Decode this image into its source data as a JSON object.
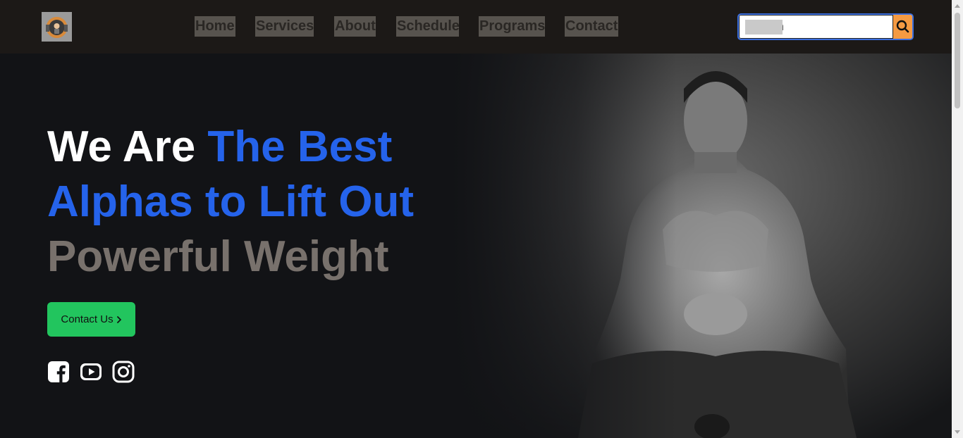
{
  "logo": {
    "icon": "gym-kettlebell-logo-icon"
  },
  "nav": {
    "items": [
      {
        "label": "Home"
      },
      {
        "label": "Services"
      },
      {
        "label": "About"
      },
      {
        "label": "Schedule"
      },
      {
        "label": "Programs"
      },
      {
        "label": "Contact"
      }
    ]
  },
  "search": {
    "placeholder": "Search",
    "button_icon": "search-icon",
    "button_color": "#f59a42",
    "border_color": "#3b6fe0"
  },
  "hero": {
    "headline_parts": {
      "we_are": "We Are ",
      "the_best": "The Best",
      "alphas": "Alphas to Lift Out",
      "powerful": "Powerful Weight"
    },
    "colors": {
      "white": "#ffffff",
      "blue": "#2563eb",
      "gray": "#78716c"
    },
    "cta": {
      "label": "Contact Us",
      "icon": "chevron-right-icon",
      "color": "#22c55e"
    },
    "socials": [
      {
        "icon": "facebook-icon"
      },
      {
        "icon": "youtube-icon"
      },
      {
        "icon": "instagram-icon"
      }
    ],
    "image": {
      "icon": "bodybuilder-photo"
    }
  }
}
